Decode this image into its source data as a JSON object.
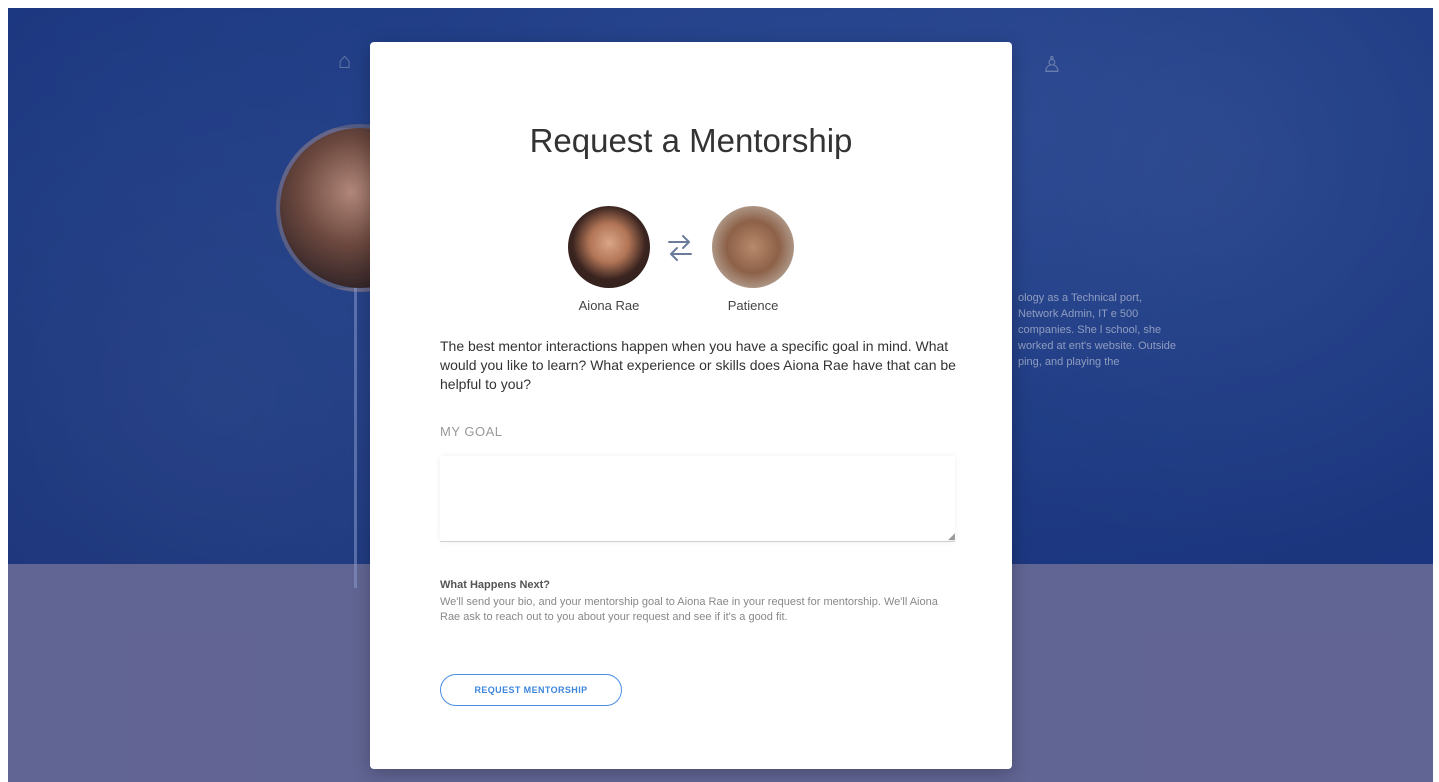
{
  "modal": {
    "title": "Request a Mentorship",
    "mentor_name": "Aiona Rae",
    "mentee_name": "Patience",
    "intro_text": "The best mentor interactions happen when you have a specific goal in mind. What would you like to learn? What experience or skills does Aiona Rae have that can be helpful to you?",
    "goal_label": "MY GOAL",
    "goal_value": "",
    "next_title": "What Happens Next?",
    "next_body": "We'll send your bio, and your mentorship goal to Aiona Rae in your request for mentorship. We'll Aiona Rae ask to reach out to you about your request and see if it's a good fit.",
    "request_button_label": "REQUEST MENTORSHIP"
  },
  "background": {
    "bio_fragment": "ology as a Technical port, Network Admin, IT e 500 companies. She l school, she worked at ent's website. Outside ping, and playing the",
    "top_left_icon": "home-icon",
    "top_right_icon": "user-icon"
  },
  "colors": {
    "hero_blue": "#22418d",
    "lower_band": "#6d6f9c",
    "accent_blue": "#3d86de"
  }
}
